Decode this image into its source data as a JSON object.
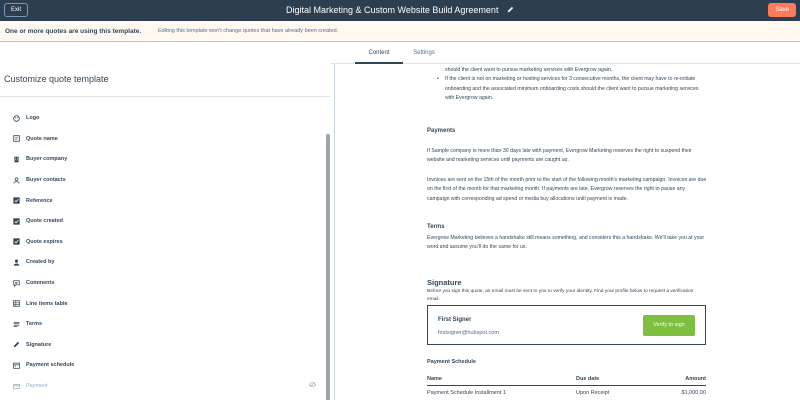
{
  "header": {
    "exit_label": "Exit",
    "title": "Digital Marketing & Custom Website Build Agreement",
    "save_label": "Save"
  },
  "notice": {
    "strong": "One or more quotes are using this template.",
    "light": "Editing this template won't change quotes that have already been created."
  },
  "tabs": [
    {
      "label": "Content",
      "active": true
    },
    {
      "label": "Settings",
      "active": false
    }
  ],
  "sidebar": {
    "title": "Customize quote template",
    "items": [
      {
        "label": "Logo",
        "icon": "palette-icon"
      },
      {
        "label": "Quote name",
        "icon": "quote-name-icon"
      },
      {
        "label": "Buyer company",
        "icon": "building-icon"
      },
      {
        "label": "Buyer contacts",
        "icon": "contact-icon"
      },
      {
        "label": "Reference",
        "icon": "checkbox-icon"
      },
      {
        "label": "Quote created",
        "icon": "checkbox-icon"
      },
      {
        "label": "Quote expires",
        "icon": "checkbox-icon"
      },
      {
        "label": "Created by",
        "icon": "user-icon"
      },
      {
        "label": "Comments",
        "icon": "comments-icon"
      },
      {
        "label": "Line items table",
        "icon": "table-icon"
      },
      {
        "label": "Terms",
        "icon": "terms-icon"
      },
      {
        "label": "Signature",
        "icon": "signature-icon"
      },
      {
        "label": "Payment schedule",
        "icon": "schedule-icon"
      },
      {
        "label": "Payment",
        "icon": "payment-icon",
        "disabled": true
      }
    ]
  },
  "preview": {
    "bullet_1_tail": "should the client want to pursue marketing services with Evergrow again.",
    "bullet_2": "If the client is not on marketing or hosting services for 3 consecutive months, the client may have to re-initiate onboarding and the associated minimum onboarding costs should the client want to pursue marketing services with Evergrow again.",
    "payments_heading": "Payments",
    "payments_p1": "If Sample company is more than 30 days late with payment, Evergrow Marketing reserves the right to suspend their website and marketing services until payments are caught up.",
    "payments_p2": "Invoices are sent on the 15th of the month prior to the start of the following month's marketing campaign. Invoices are due on the first of the month for that marketing month. If payments are late, Evergrow reserves the right to pause any campaign with corresponding ad spend or media buy allocations until payment is made.",
    "terms_heading": "Terms",
    "terms_p": "Evergrow Marketing believes a handshake still means something, and considers this a handshake. We'll take you at your word and assume you'll do the same for us.",
    "signature_heading": "Signature",
    "signature_p": "Before you sign this quote, an email must be sent to you to verify your identity. Find your profile below to request a verification email.",
    "signer_name": "First Signer",
    "signer_email": "firstsigner@hubspot.com",
    "verify_label": "Verify to sign",
    "schedule_heading": "Payment Schedule",
    "schedule_columns": [
      "Name",
      "Due date",
      "Amount"
    ],
    "schedule_rows": [
      [
        "Payment Schedule Installment 1",
        "Upon Receipt",
        "$1,000.00"
      ]
    ]
  },
  "colors": {
    "header_bg": "#2d3e50",
    "save_button": "#ff7a59",
    "notice_bg": "#fef8f0",
    "verify_button": "#7fbf3f"
  }
}
